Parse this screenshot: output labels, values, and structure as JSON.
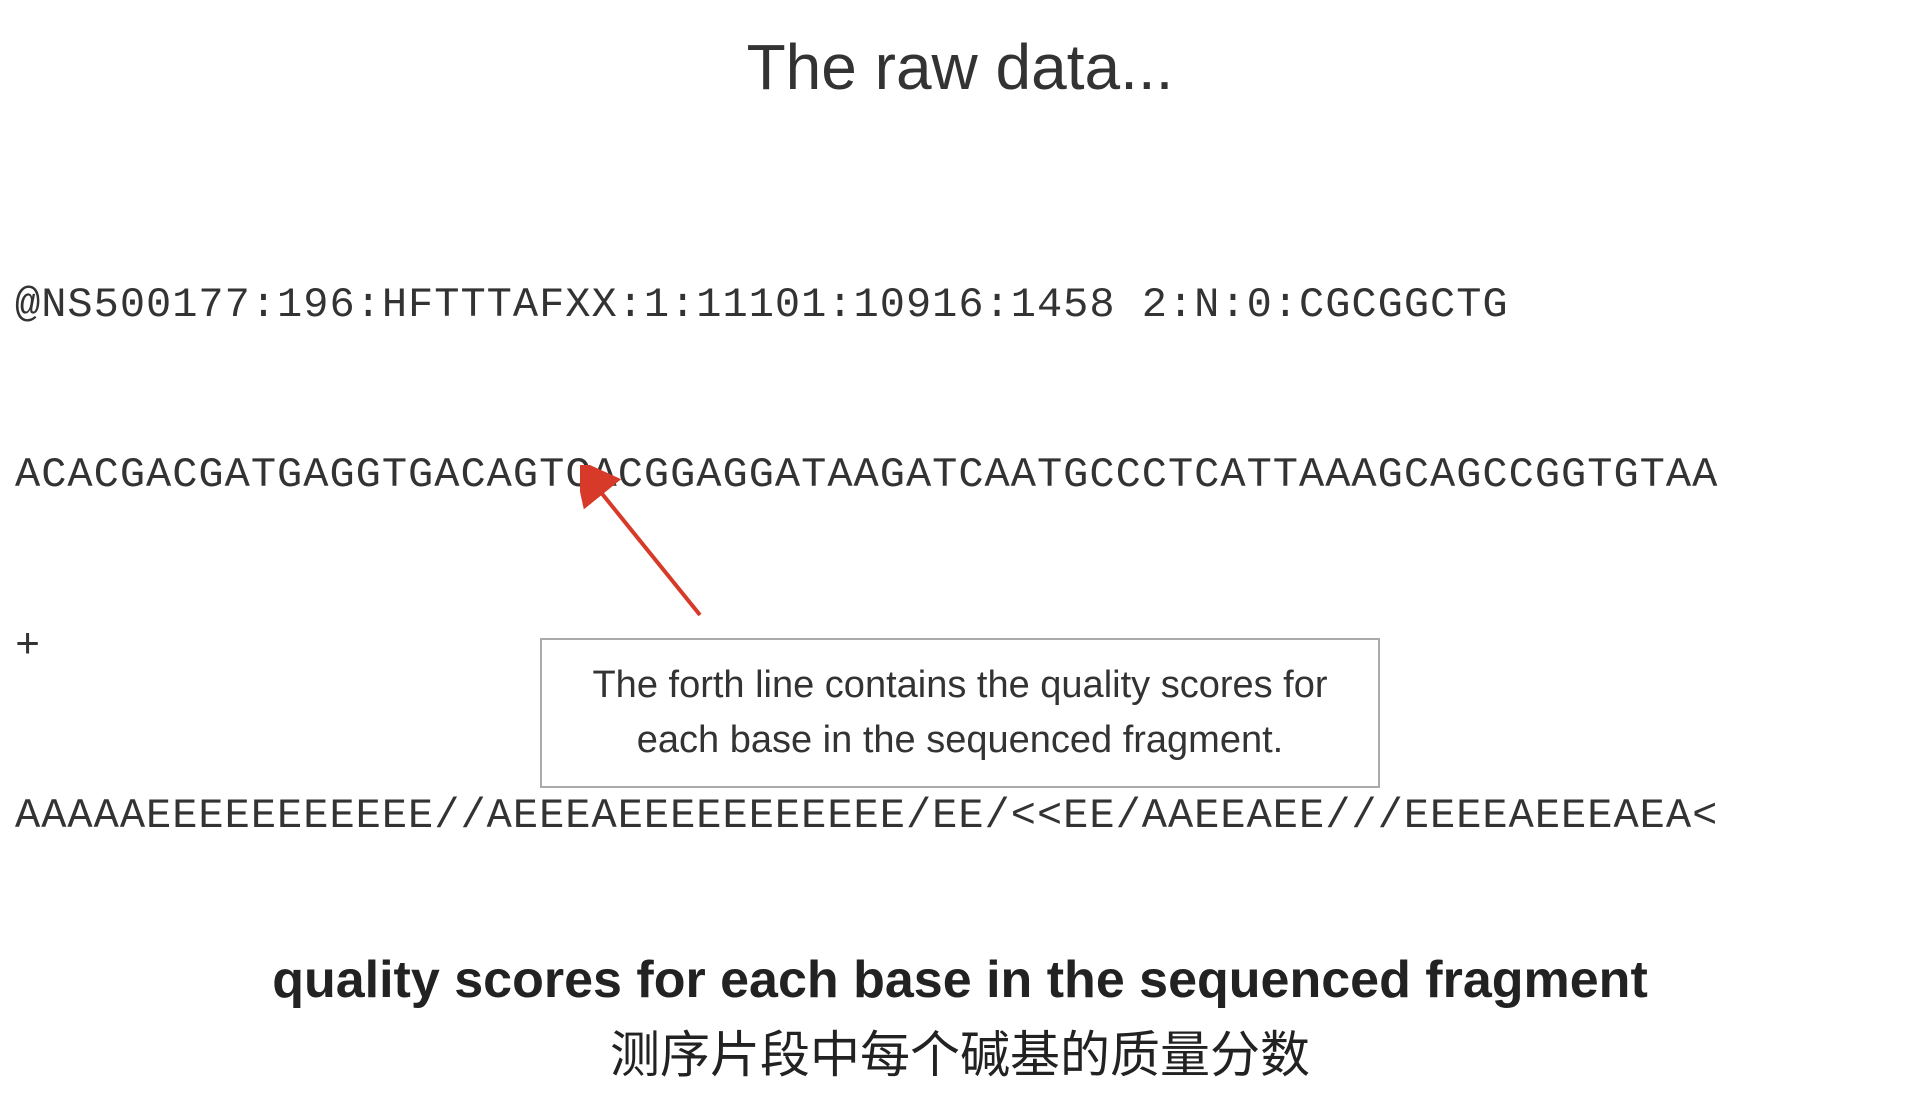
{
  "title": "The raw data...",
  "fastq": {
    "line1": "@NS500177:196:HFTTTAFXX:1:11101:10916:1458 2:N:0:CGCGGCTG",
    "line2": "ACACGACGATGAGGTGACAGTCACGGAGGATAAGATCAATGCCCTCATTAAAGCAGCCGGTGTAA",
    "line3": "+",
    "line4": "AAAAAEEEEEEEEEEE//AEEEAEEEEEEEEEEE/EE/<<EE/AAEEAEE///EEEEAEEEAEA<"
  },
  "callout": "The forth line contains the quality scores for each base in the sequenced fragment.",
  "subtitle": {
    "en": "quality scores for each base in the sequenced fragment",
    "zh": "测序片段中每个碱基的质量分数"
  },
  "colors": {
    "arrow": "#d83a2a"
  }
}
